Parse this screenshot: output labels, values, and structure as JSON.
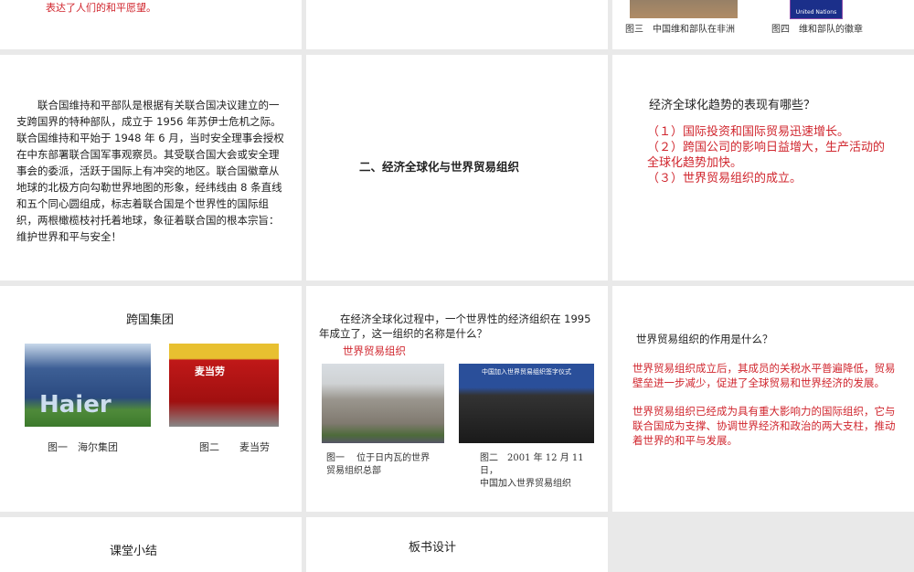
{
  "slides": [
    {
      "text": "表达了人们的和平愿望。"
    },
    {},
    {
      "caption3": "图三　中国维和部队在非洲",
      "caption4": "图四　维和部队的徽章",
      "emblem_text": "United Nations"
    },
    {
      "text": "　　联合国维持和平部队是根据有关联合国决议建立的一支跨国界的特种部队，成立于 1956 年苏伊士危机之际。联合国维持和平始于 1948 年 6 月，当时安全理事会授权在中东部署联合国军事观察员。其受联合国大会或安全理事会的委派，活跃于国际上有冲突的地区。联合国徽章从地球的北极方向勾勒世界地图的形象，经纬线由 8 条直线和五个同心圆组成，标志着联合国是个世界性的国际组织，两根橄榄枝衬托着地球，象征着联合国的根本宗旨：维护世界和平与安全！"
    },
    {
      "title": "二、经济全球化与世界贸易组织"
    },
    {
      "question": "经济全球化趋势的表现有哪些？",
      "answers": [
        "（１）国际投资和国际贸易迅速增长。",
        "（２）跨国公司的影响日益增大，生产活动的全球化趋势加快。",
        "（３）世界贸易组织的成立。"
      ]
    },
    {
      "title": "跨国集团",
      "caption1": "图一　海尔集团",
      "caption2": "图二　　麦当劳",
      "haier_logo": "Haier",
      "mcd_sign": "麦当劳"
    },
    {
      "question": "　　在经济全球化过程中，一个世界性的经济组织在 1995 年成立了，这一组织的名称是什么？",
      "answer": "世界贸易组织",
      "caption1": "图一　 位于日内瓦的世界贸易组织总部",
      "caption2": "图二　2001 年 12 月 11 日，",
      "caption2b": "中国加入世界贸易组织",
      "banner": "中国加入世界贸易组织签字仪式"
    },
    {
      "question": "世界贸易组织的作用是什么？",
      "answer1": "世界贸易组织成立后，其成员的关税水平普遍降低，贸易壁垒进一步减少，促进了全球贸易和世界经济的发展。",
      "answer2": "世界贸易组织已经成为具有重大影响力的国际组织，它与联合国成为支撑、协调世界经济和政治的两大支柱，推动着世界的和平与发展。"
    },
    {
      "title": "课堂小结"
    },
    {
      "title": "板书设计"
    }
  ]
}
